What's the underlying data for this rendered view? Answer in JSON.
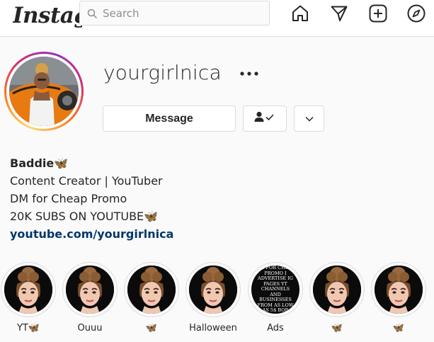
{
  "nav": {
    "logo_text": "Instagram",
    "search_placeholder": "Search",
    "icons": [
      "home-icon",
      "direct-icon",
      "new-post-icon",
      "explore-icon"
    ]
  },
  "profile": {
    "username": "yourgirlnica",
    "message_label": "Message",
    "bio": {
      "name": "Baddie🦋",
      "line1": "Content Creator | YouTuber",
      "line2": "DM for Cheap Promo",
      "line3": "20K SUBS ON YOUTUBE🦋",
      "link": "youtube.com/yourgirlnica"
    }
  },
  "highlights": [
    {
      "label": "YT🦋",
      "type": "avatar"
    },
    {
      "label": "Ouuu",
      "type": "avatar"
    },
    {
      "label": "🦋",
      "type": "avatar"
    },
    {
      "label": "Halloween",
      "type": "avatar"
    },
    {
      "label": "Ads",
      "type": "text",
      "text": "DM FOR CHEAP PROMO I ADVERTISE IG PAGES YT CHANNELS AND BUSINESSES FROM AS LOW AS 5$ BOB"
    },
    {
      "label": "🦋",
      "type": "avatar"
    },
    {
      "label": "🦋",
      "type": "avatar"
    }
  ],
  "colors": {
    "link": "#00376b",
    "border": "#dbdbdb",
    "text": "#262626",
    "background": "#fafafa"
  }
}
